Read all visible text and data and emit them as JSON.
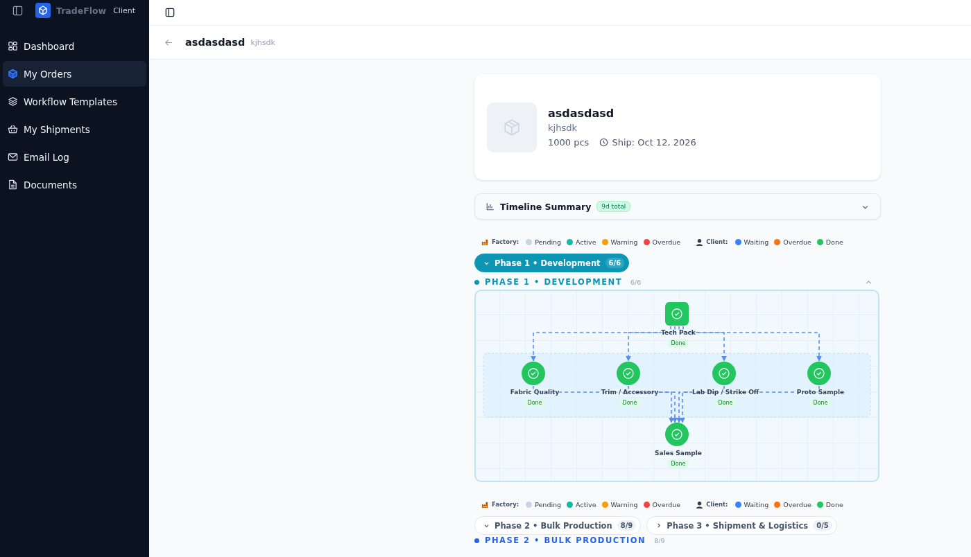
{
  "brand": {
    "name": "TradeFlow",
    "role": "Client"
  },
  "sidebar": {
    "items": [
      {
        "label": "Dashboard",
        "selected": false
      },
      {
        "label": "My Orders",
        "selected": true
      },
      {
        "label": "Workflow Templates",
        "selected": false
      },
      {
        "label": "My Shipments",
        "selected": false
      },
      {
        "label": "Email Log",
        "selected": false
      },
      {
        "label": "Documents",
        "selected": false
      }
    ]
  },
  "header": {
    "title": "asdasdasd",
    "subtitle": "kjhsdk"
  },
  "order": {
    "name": "asdasdasd",
    "customer": "kjhsdk",
    "quantity": "1000 pcs",
    "ship_date": "Ship: Oct 12, 2026"
  },
  "timeline_summary": {
    "title": "Timeline Summary",
    "badge": "9d total",
    "expanded": false
  },
  "legend": {
    "factory_label": "Factory:",
    "client_label": "Client:",
    "factory": [
      {
        "label": "Pending",
        "color": "#cbd5e1"
      },
      {
        "label": "Active",
        "color": "#14b8a6"
      },
      {
        "label": "Warning",
        "color": "#f59e0b"
      },
      {
        "label": "Overdue",
        "color": "#ef4444"
      }
    ],
    "client": [
      {
        "label": "Waiting",
        "color": "#3b82f6"
      },
      {
        "label": "Overdue",
        "color": "#f97316"
      },
      {
        "label": "Done",
        "color": "#22c55e"
      }
    ]
  },
  "legend_2": {
    "factory_label": "Factory:",
    "client_label": "Client:",
    "factory": [
      {
        "label": "Pending",
        "color": "#cbd5e1"
      },
      {
        "label": "Active",
        "color": "#14b8a6"
      },
      {
        "label": "Warning",
        "color": "#f59e0b"
      },
      {
        "label": "Overdue",
        "color": "#ef4444"
      }
    ],
    "client": [
      {
        "label": "Waiting",
        "color": "#3b82f6"
      },
      {
        "label": "Overdue",
        "color": "#f97316"
      },
      {
        "label": "Done",
        "color": "#22c55e"
      }
    ]
  },
  "phase_1": {
    "tab": {
      "label": "Phase 1 • Development",
      "count": "6/6",
      "selected": true,
      "expanded": true
    },
    "heading": "PHASE 1 • DEVELOPMENT",
    "count": "6/6",
    "color": "#0e95b3",
    "expanded": true,
    "diagram": {
      "start": {
        "label": "Tech Pack",
        "status": "Done",
        "kind": "square"
      },
      "parallel": [
        {
          "label": "Fabric Quality",
          "status": "Done",
          "kind": "circle"
        },
        {
          "label": "Trim / Accessory",
          "status": "Done",
          "kind": "circle"
        },
        {
          "label": "Lab Dip / Strike Off",
          "status": "Done",
          "kind": "circle"
        },
        {
          "label": "Proto Sample",
          "status": "Done",
          "kind": "circle"
        }
      ],
      "end": {
        "label": "Sales Sample",
        "status": "Done",
        "kind": "circle"
      }
    }
  },
  "phase_tabs": [
    {
      "label": "Phase 2 • Bulk Production",
      "count": "8/9",
      "selected": false,
      "expanded": true
    },
    {
      "label": "Phase 3 • Shipment & Logistics",
      "count": "0/5",
      "selected": false,
      "expanded": false
    }
  ],
  "phase_2": {
    "heading": "PHASE 2 • BULK PRODUCTION",
    "count": "8/9",
    "color": "#2563eb"
  }
}
